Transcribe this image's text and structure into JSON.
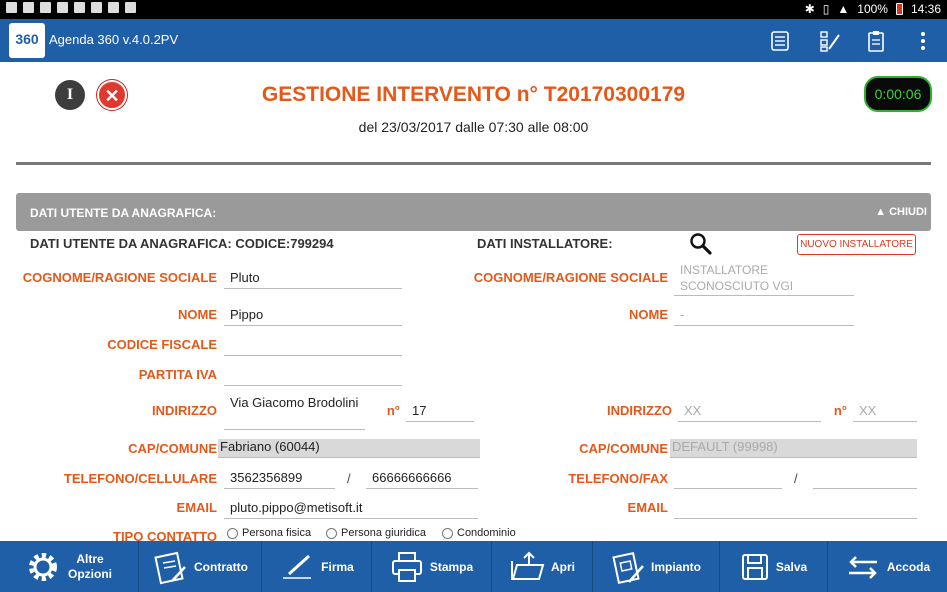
{
  "statusbar": {
    "battery": "100%",
    "time": "14:36"
  },
  "app": {
    "logo": "360",
    "title": "Agenda 360 v.4.0.2PV"
  },
  "appbar_icons": [
    "list-icon",
    "sitemap-edit-icon",
    "clipboard-icon",
    "more-vert-icon"
  ],
  "header": {
    "info": "I",
    "close": "✕",
    "title": "GESTIONE INTERVENTO n° T20170300179",
    "subtitle": "del 23/03/2017 dalle 07:30 alle 08:00",
    "timer": "0:00:06"
  },
  "section": {
    "title": "DATI UTENTE DA ANAGRAFICA:",
    "toggle": "▲ CHIUDI"
  },
  "customer": {
    "header": "DATI UTENTE DA ANAGRAFICA:  CODICE:799294",
    "surname_label": "COGNOME/RAGIONE SOCIALE",
    "surname": "Pluto",
    "name_label": "NOME",
    "name": "Pippo",
    "tax_code_label": "CODICE FISCALE",
    "tax_code": "",
    "vat_label": "PARTITA IVA",
    "vat": "",
    "address_label": "INDIRIZZO",
    "address": "Via Giacomo Brodolini",
    "number_label": "n°",
    "number": "17",
    "zip_label": "CAP/COMUNE",
    "zip": "Fabriano (60044)",
    "phone_label": "TELEFONO/CELLULARE",
    "phone": "3562356899",
    "slash": "/",
    "mobile": "66666666666",
    "email_label": "EMAIL",
    "email": "pluto.pippo@metisoft.it",
    "contact_type_label": "TIPO CONTATTO",
    "contact_types": [
      "Persona fisica",
      "Persona giuridica",
      "Condominio"
    ]
  },
  "installer": {
    "header": "DATI INSTALLATORE:",
    "new_button": "NUOVO INSTALLATORE",
    "surname_label": "COGNOME/RAGIONE SOCIALE",
    "surname": "INSTALLATORE SCONOSCIUTO VGI",
    "name_label": "NOME",
    "name": "-",
    "address_label": "INDIRIZZO",
    "address": "XX",
    "number_label": "n°",
    "number": "XX",
    "zip_label": "CAP/COMUNE",
    "zip": "DEFAULT (99998)",
    "phone_label": "TELEFONO/FAX",
    "phone": "",
    "slash": "/",
    "fax": "",
    "email_label": "EMAIL",
    "email": ""
  },
  "bottombar": {
    "other": "Altre Opzioni",
    "contract": "Contratto",
    "sign": "Firma",
    "print": "Stampa",
    "open": "Apri",
    "plant": "Impianto",
    "save": "Salva",
    "queue": "Accoda"
  }
}
